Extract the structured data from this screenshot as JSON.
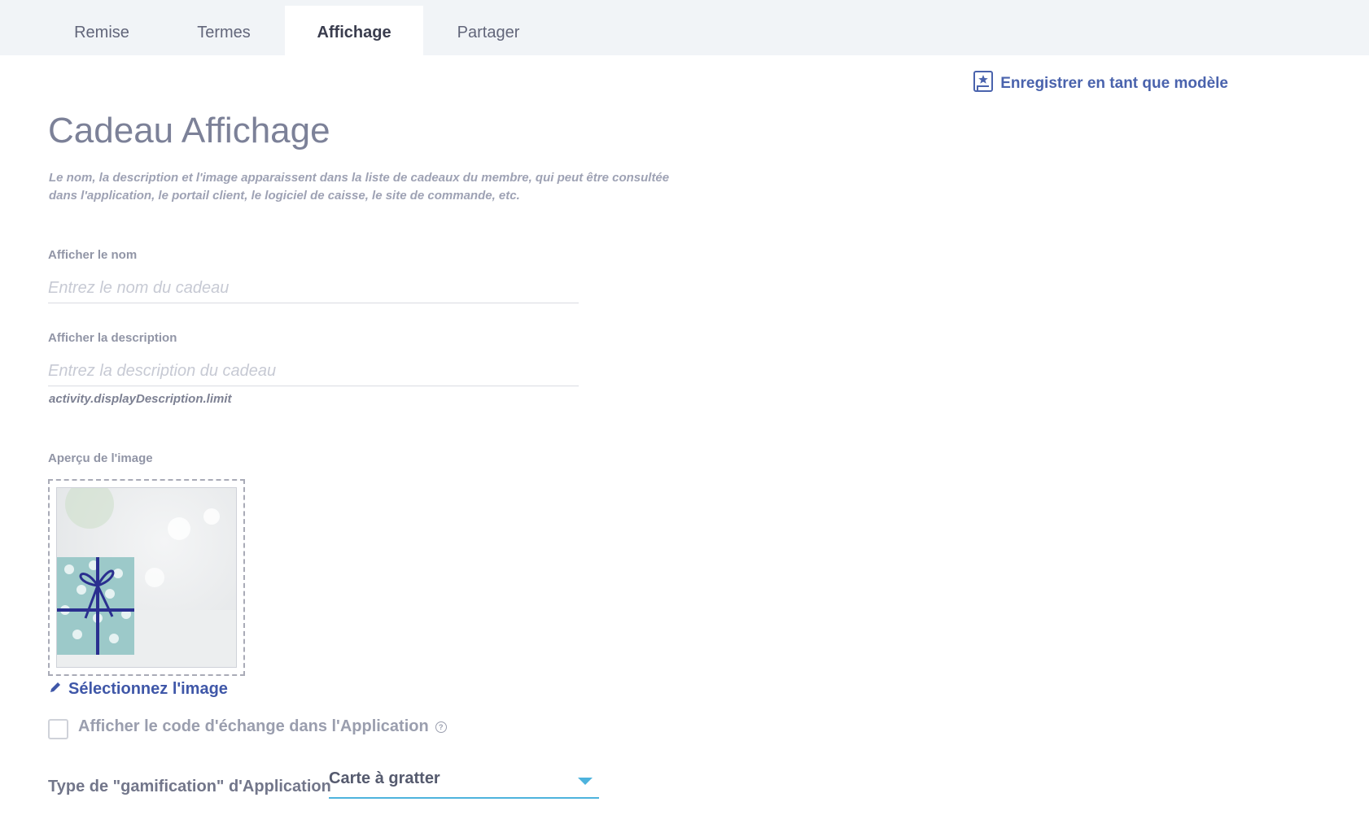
{
  "tabs": [
    {
      "label": "Remise",
      "active": false
    },
    {
      "label": "Termes",
      "active": false
    },
    {
      "label": "Affichage",
      "active": true
    },
    {
      "label": "Partager",
      "active": false
    }
  ],
  "actions": {
    "save_template_label": "Enregistrer en tant que modèle",
    "save_template_icon": "template-save-icon"
  },
  "page": {
    "title": "Cadeau Affichage",
    "intro": "Le nom, la description et l'image apparaissent dans la liste de cadeaux du membre, qui peut être consultée dans l'application, le portail client, le logiciel de caisse, le site de commande, etc."
  },
  "form": {
    "name": {
      "label": "Afficher le nom",
      "placeholder": "Entrez le nom du cadeau",
      "value": ""
    },
    "description": {
      "label": "Afficher la description",
      "placeholder": "Entrez la description du cadeau",
      "value": "",
      "hint": "activity.displayDescription.limit"
    },
    "image": {
      "label": "Aperçu de l'image",
      "select_label": "Sélectionnez l'image",
      "select_icon": "pencil-icon"
    },
    "show_code": {
      "label": "Afficher le code d'échange dans l'Application",
      "checked": false,
      "help_icon": "question-circle-icon",
      "help_glyph": "?"
    },
    "gamification": {
      "label": "Type de \"gamification\" d'Application",
      "selected": "Carte à gratter"
    }
  },
  "colors": {
    "accent": "#4a63ad",
    "select_underline": "#4db3dd",
    "tabbar_bg": "#f1f4f7"
  }
}
